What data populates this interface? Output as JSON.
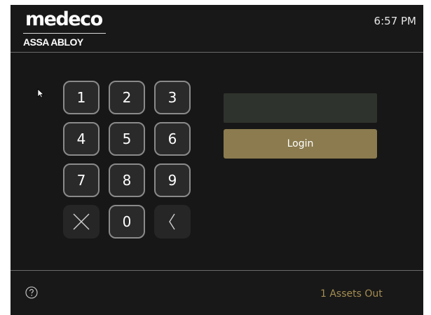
{
  "header": {
    "logo_main": "medeco",
    "logo_sub": "ASSA ABLOY",
    "clock": "6:57 PM"
  },
  "keypad": {
    "keys": [
      "1",
      "2",
      "3",
      "4",
      "5",
      "6",
      "7",
      "8",
      "9",
      "×",
      "0",
      "‹"
    ],
    "clear_icon": "x-icon",
    "backspace_icon": "chevron-left-icon"
  },
  "login": {
    "pin_value": "",
    "button_label": "Login",
    "button_color": "#8b7b4e"
  },
  "footer": {
    "help_icon": "question-circle-icon",
    "assets_out": "1 Assets Out",
    "assets_color": "#a58d52"
  }
}
